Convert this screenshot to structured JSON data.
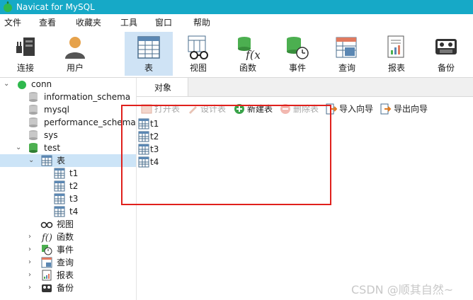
{
  "app": {
    "title": "Navicat for MySQL"
  },
  "menu": [
    "文件",
    "查看",
    "收藏夹",
    "工具",
    "窗口",
    "帮助"
  ],
  "toolbar": {
    "items": [
      {
        "label": "连接",
        "icon": "plug-icon"
      },
      {
        "label": "用户",
        "icon": "user-icon"
      },
      {
        "label": "表",
        "icon": "table-icon",
        "active": true
      },
      {
        "label": "视图",
        "icon": "view-glasses-icon"
      },
      {
        "label": "函数",
        "icon": "function-icon"
      },
      {
        "label": "事件",
        "icon": "event-clock-icon"
      },
      {
        "label": "查询",
        "icon": "query-icon"
      },
      {
        "label": "报表",
        "icon": "report-icon"
      },
      {
        "label": "备份",
        "icon": "backup-icon"
      }
    ]
  },
  "tree": {
    "connection": "conn",
    "databases": [
      "information_schema",
      "mysql",
      "performance_schema",
      "sys",
      "test"
    ],
    "tables_label": "表",
    "tables": [
      "t1",
      "t2",
      "t3",
      "t4"
    ],
    "views_label": "视图",
    "functions_label": "函数",
    "events_label": "事件",
    "queries_label": "查询",
    "reports_label": "报表",
    "backups_label": "备份"
  },
  "main": {
    "tab": "对象",
    "actions": {
      "open": "打开表",
      "design": "设计表",
      "new": "新建表",
      "delete": "删除表",
      "import": "导入向导",
      "export": "导出向导"
    },
    "table_list": [
      "t1",
      "t2",
      "t3",
      "t4"
    ]
  },
  "watermark": "CSDN @顺其自然~",
  "colors": {
    "titlebar": "#16a9c7",
    "selection": "#cce4f7",
    "highlight_box": "#e0201c"
  }
}
